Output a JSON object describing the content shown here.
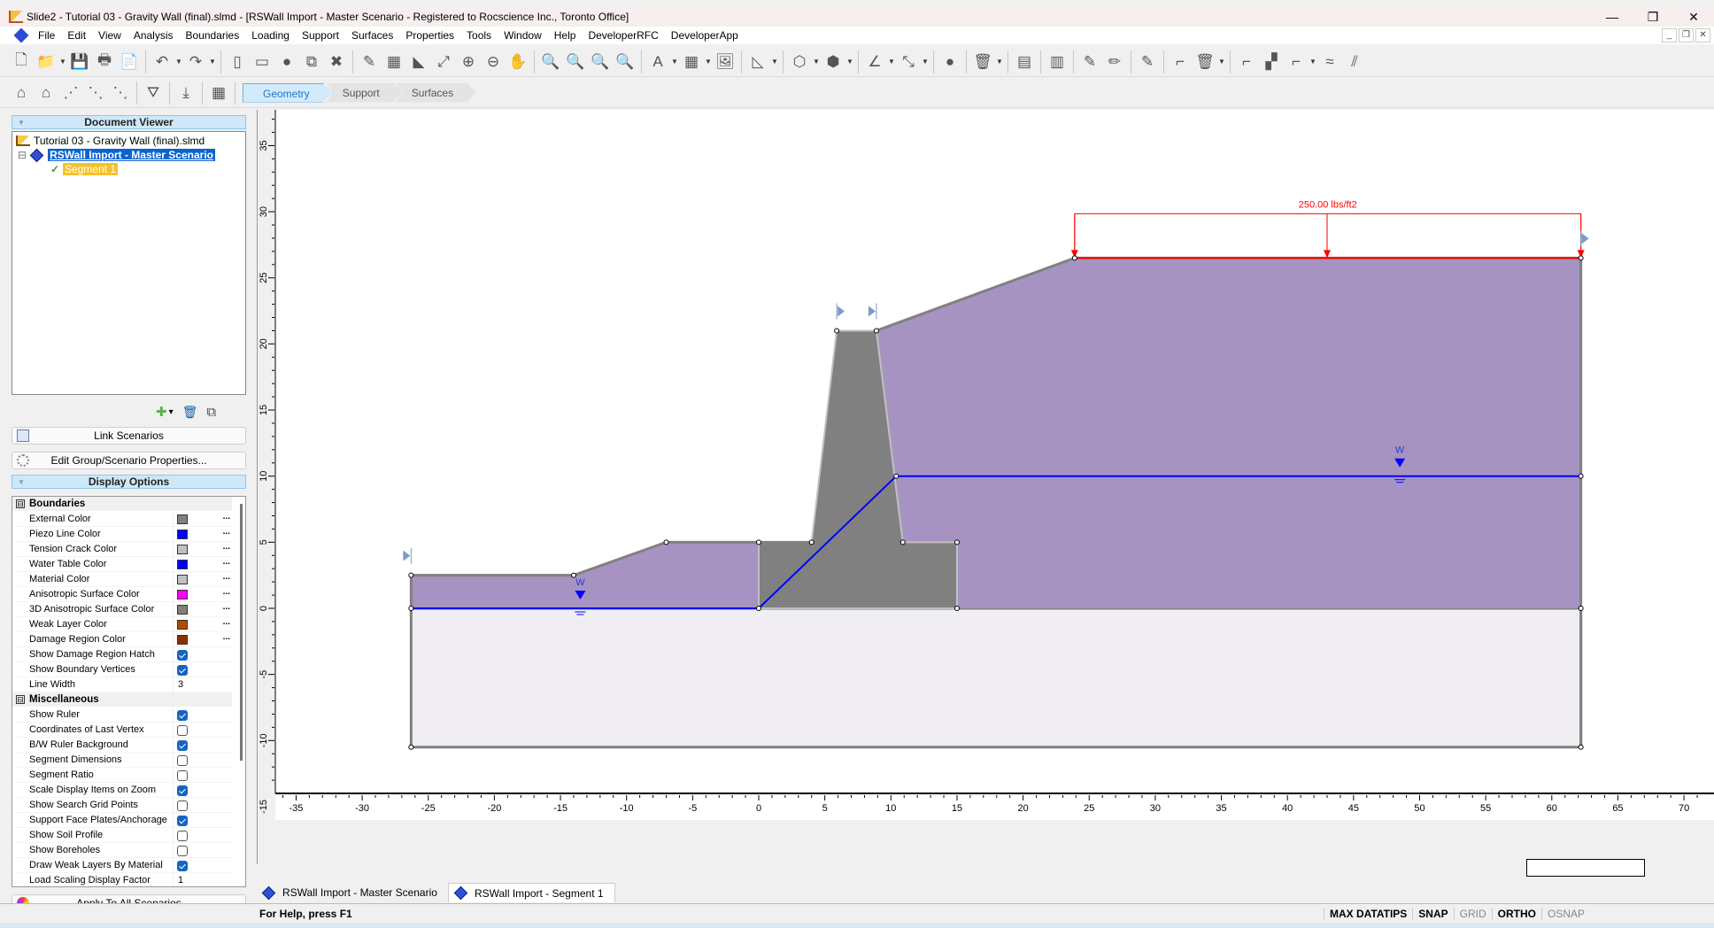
{
  "window": {
    "title": "Slide2 - Tutorial 03 - Gravity Wall (final).slmd - [RSWall Import - Master Scenario - Registered to Rocscience Inc., Toronto Office]",
    "controls": {
      "minimize": "—",
      "maximize": "❐",
      "close": "✕"
    },
    "mdi_controls": {
      "minimize": "_",
      "restore": "❐",
      "close": "✕"
    }
  },
  "menu": [
    "File",
    "Edit",
    "View",
    "Analysis",
    "Boundaries",
    "Loading",
    "Support",
    "Surfaces",
    "Properties",
    "Tools",
    "Window",
    "Help",
    "DeveloperRFC",
    "DeveloperApp"
  ],
  "toolbar1": [
    {
      "name": "new-icon",
      "glyph": "🗋"
    },
    {
      "name": "open-icon",
      "glyph": "📁",
      "dd": true
    },
    {
      "name": "save-icon",
      "glyph": "💾"
    },
    {
      "name": "print-icon",
      "glyph": "🖶"
    },
    {
      "name": "print-preview-icon",
      "glyph": "📄"
    },
    {
      "sep": true
    },
    {
      "name": "undo-icon",
      "glyph": "↶",
      "dd": true
    },
    {
      "name": "redo-icon",
      "glyph": "↷",
      "dd": true
    },
    {
      "sep": true
    },
    {
      "name": "split-vertical-icon",
      "glyph": "▯"
    },
    {
      "name": "split-horizontal-icon",
      "glyph": "▭"
    },
    {
      "name": "color-wheel-icon",
      "glyph": "●"
    },
    {
      "name": "link-windows-icon",
      "glyph": "⧉"
    },
    {
      "name": "close-window-icon",
      "glyph": "✖"
    },
    {
      "sep": true
    },
    {
      "name": "edit-tool-icon",
      "glyph": "✎"
    },
    {
      "name": "calculator-icon",
      "glyph": "▦"
    },
    {
      "name": "chart-icon",
      "glyph": "◣"
    },
    {
      "name": "zoom-all-icon",
      "glyph": "⤢"
    },
    {
      "name": "zoom-in-icon",
      "glyph": "⊕"
    },
    {
      "name": "zoom-out-icon",
      "glyph": "⊖"
    },
    {
      "name": "pan-icon",
      "glyph": "✋"
    },
    {
      "sep": true
    },
    {
      "name": "zoom-window-icon",
      "glyph": "🔍"
    },
    {
      "name": "zoom-extents-icon",
      "glyph": "🔍"
    },
    {
      "name": "zoom-previous-icon",
      "glyph": "🔍"
    },
    {
      "name": "zoom-lock-icon",
      "glyph": "🔍"
    },
    {
      "sep": true
    },
    {
      "name": "text-box-icon",
      "glyph": "A",
      "dd": true
    },
    {
      "name": "table-icon",
      "glyph": "▦",
      "dd": true
    },
    {
      "name": "image-icon",
      "glyph": "🖼"
    },
    {
      "sep": true
    },
    {
      "name": "ruler-triangle-icon",
      "glyph": "◺",
      "dd": true
    },
    {
      "sep": true
    },
    {
      "name": "polyline-icon",
      "glyph": "⬡",
      "dd": true
    },
    {
      "name": "polygon-icon",
      "glyph": "⬢",
      "dd": true
    },
    {
      "sep": true
    },
    {
      "name": "angle-icon",
      "glyph": "∠",
      "dd": true
    },
    {
      "name": "dimension-icon",
      "glyph": "⤡",
      "dd": true
    },
    {
      "sep": true
    },
    {
      "name": "sphere-icon",
      "glyph": "●"
    },
    {
      "sep": true
    },
    {
      "name": "delete-icon",
      "glyph": "🗑",
      "dd": true
    },
    {
      "sep": true
    },
    {
      "name": "material-layers-icon",
      "glyph": "▤"
    },
    {
      "sep": true
    },
    {
      "name": "assign-materials-icon",
      "glyph": "▥"
    },
    {
      "sep": true
    },
    {
      "name": "edit-boundary-icon",
      "glyph": "✎"
    },
    {
      "name": "pencil-icon",
      "glyph": "✏"
    },
    {
      "sep": true
    },
    {
      "name": "edit-slope-icon",
      "glyph": "✎"
    },
    {
      "sep": true
    },
    {
      "name": "add-boundary-disabled-icon",
      "glyph": "⌐"
    },
    {
      "name": "delete-boundary-icon",
      "glyph": "🗑",
      "dd": true
    },
    {
      "sep": true
    },
    {
      "name": "external-boundary-icon",
      "glyph": "⌐"
    },
    {
      "name": "tension-crack-icon",
      "glyph": "▞"
    },
    {
      "name": "water-table-icon",
      "glyph": "⌐",
      "dd": true
    },
    {
      "name": "weak-layer-icon",
      "glyph": "≈"
    },
    {
      "name": "anisotropic-icon",
      "glyph": "⫽"
    }
  ],
  "toolbar2": [
    {
      "name": "delete-boundary-vertex-icon",
      "glyph": "⌂"
    },
    {
      "name": "move-boundary-icon",
      "glyph": "⌂"
    },
    {
      "name": "add-vertex-icon",
      "glyph": "⋰"
    },
    {
      "name": "rotate-vertex-icon",
      "glyph": "⋱"
    },
    {
      "name": "delete-vertex-icon",
      "glyph": "⋱"
    },
    {
      "sep": true
    },
    {
      "name": "filter-icon",
      "glyph": "⛛"
    },
    {
      "sep": true
    },
    {
      "name": "import-icon",
      "glyph": "⤓"
    },
    {
      "sep": true
    },
    {
      "name": "rswall-icon",
      "glyph": "▦"
    }
  ],
  "workflow_tabs": [
    "Geometry",
    "Support",
    "Surfaces"
  ],
  "document_viewer": {
    "title": "Document Viewer",
    "file": "Tutorial 03 - Gravity Wall (final).slmd",
    "scenario": "RSWall Import - Master Scenario",
    "segment": "Segment 1",
    "expander": "⊟",
    "check": "✓",
    "actions": {
      "add": "✚",
      "add_dd": "▾",
      "delete": "🗑",
      "copy": "⧉"
    }
  },
  "buttons": {
    "link_scenarios": "Link Scenarios",
    "edit_group": "Edit Group/Scenario Properties...",
    "apply_all": "Apply To All Scenarios"
  },
  "display_options": {
    "title": "Display Options",
    "categories": [
      {
        "name": "Boundaries",
        "rows": [
          {
            "label": "External Color",
            "type": "color",
            "value": "#808080"
          },
          {
            "label": "Piezo Line Color",
            "type": "color",
            "value": "#0000ff"
          },
          {
            "label": "Tension Crack Color",
            "type": "color",
            "value": "#c0c0c0"
          },
          {
            "label": "Water Table Color",
            "type": "color",
            "value": "#0000ff"
          },
          {
            "label": "Material Color",
            "type": "color",
            "value": "#c0c0c0"
          },
          {
            "label": "Anisotropic Surface Color",
            "type": "color",
            "value": "#ff00ff"
          },
          {
            "label": "3D Anisotropic Surface Color",
            "type": "color",
            "value": "#808080"
          },
          {
            "label": "Weak Layer Color",
            "type": "color",
            "value": "#b04a00"
          },
          {
            "label": "Damage Region Color",
            "type": "color",
            "value": "#8b3000"
          },
          {
            "label": "Show Damage Region Hatch",
            "type": "check",
            "value": true
          },
          {
            "label": "Show Boundary Vertices",
            "type": "check",
            "value": true
          },
          {
            "label": "Line Width",
            "type": "number",
            "value": "3"
          }
        ]
      },
      {
        "name": "Miscellaneous",
        "rows": [
          {
            "label": "Show Ruler",
            "type": "check",
            "value": true
          },
          {
            "label": "Coordinates of Last Vertex",
            "type": "check",
            "value": false
          },
          {
            "label": "B/W Ruler Background",
            "type": "check",
            "value": true
          },
          {
            "label": "Segment Dimensions",
            "type": "check",
            "value": false
          },
          {
            "label": "Segment Ratio",
            "type": "check",
            "value": false
          },
          {
            "label": "Scale Display Items on Zoom",
            "type": "check",
            "value": true
          },
          {
            "label": "Show Search Grid Points",
            "type": "check",
            "value": false
          },
          {
            "label": "Support Face Plates/Anchorage",
            "type": "check",
            "value": true
          },
          {
            "label": "Show Soil Profile",
            "type": "check",
            "value": false
          },
          {
            "label": "Show Boreholes",
            "type": "check",
            "value": false
          },
          {
            "label": "Draw Weak Layers By Material",
            "type": "check",
            "value": true
          },
          {
            "label": "Load Scaling Display Factor",
            "type": "number",
            "value": "1"
          }
        ]
      }
    ],
    "ellipsis": "...",
    "collapse": "⊟"
  },
  "model": {
    "colors": {
      "soil": "#a693c2",
      "wall": "#808080",
      "foundation": "#f0eef2",
      "boundary": "#808080",
      "water": "#0000ff",
      "load": "#ff0000",
      "interface": "#c0c0c0"
    },
    "x_ticks": [
      -35,
      -30,
      -25,
      -20,
      -15,
      -10,
      -5,
      0,
      5,
      10,
      15,
      20,
      25,
      30,
      35,
      40,
      45,
      50,
      55,
      60,
      65,
      70
    ],
    "y_ticks": [
      35,
      30,
      25,
      20,
      15,
      10,
      5,
      0,
      -5,
      -10,
      -15
    ],
    "x_range": [
      -39,
      71.5
    ],
    "y_range": [
      -19,
      38
    ],
    "soil_polygon": [
      [
        -26.3,
        0
      ],
      [
        -26.3,
        2.5
      ],
      [
        -14,
        2.5
      ],
      [
        -7,
        5
      ],
      [
        0,
        5
      ],
      [
        0,
        0
      ]
    ],
    "backfill_polygon": [
      [
        8.9,
        21
      ],
      [
        23.9,
        26.5
      ],
      [
        62.2,
        26.5
      ],
      [
        62.2,
        0
      ],
      [
        15,
        0
      ],
      [
        15,
        5
      ],
      [
        10.9,
        5
      ]
    ],
    "wall_polygon": [
      [
        0,
        0
      ],
      [
        0,
        5
      ],
      [
        4,
        5
      ],
      [
        5.9,
        21
      ],
      [
        8.9,
        21
      ],
      [
        10.9,
        5
      ],
      [
        15,
        5
      ],
      [
        15,
        0
      ]
    ],
    "foundation_polygon": [
      [
        -26.3,
        0
      ],
      [
        62.2,
        0
      ],
      [
        62.2,
        -10.5
      ],
      [
        -26.3,
        -10.5
      ]
    ],
    "vertices": [
      [
        -26.3,
        2.5
      ],
      [
        -14,
        2.5
      ],
      [
        -7,
        5
      ],
      [
        0,
        5
      ],
      [
        0,
        0
      ],
      [
        4,
        5
      ],
      [
        5.9,
        21
      ],
      [
        8.9,
        21
      ],
      [
        10.4,
        10
      ],
      [
        10.9,
        5
      ],
      [
        15,
        5
      ],
      [
        15,
        0
      ],
      [
        -26.3,
        0
      ],
      [
        23.9,
        26.5
      ],
      [
        62.2,
        26.5
      ],
      [
        62.2,
        10
      ],
      [
        62.2,
        0
      ],
      [
        62.2,
        -10.5
      ],
      [
        -26.3,
        -10.5
      ]
    ],
    "water_table": [
      [
        -26.3,
        0
      ],
      [
        0,
        0
      ],
      [
        10.4,
        10
      ],
      [
        62.2,
        10
      ]
    ],
    "water_markers": [
      {
        "x": -13.5,
        "y": 0,
        "label": "W"
      },
      {
        "x": 48.5,
        "y": 10,
        "label": "W"
      }
    ],
    "load": {
      "label": "250.00 lbs/ft2",
      "x1": 23.9,
      "x2": 62.2,
      "y": 26.5,
      "arrows": [
        23.9,
        43,
        62.2
      ]
    },
    "limit_markers": [
      {
        "x": -26.3,
        "y": 2.5,
        "dir": "right"
      },
      {
        "x": 5.9,
        "y": 21,
        "dir": "left"
      },
      {
        "x": 8.9,
        "y": 21,
        "dir": "right"
      },
      {
        "x": 62.2,
        "y": 26.5,
        "dir": "left"
      }
    ]
  },
  "doc_tabs": [
    "RSWall Import - Master Scenario",
    "RSWall Import - Segment 1"
  ],
  "status": {
    "help": "For Help, press F1",
    "items": [
      {
        "label": "MAX DATATIPS",
        "on": true
      },
      {
        "label": "SNAP",
        "on": true
      },
      {
        "label": "GRID",
        "on": false
      },
      {
        "label": "ORTHO",
        "on": true
      },
      {
        "label": "OSNAP",
        "on": false
      }
    ]
  }
}
